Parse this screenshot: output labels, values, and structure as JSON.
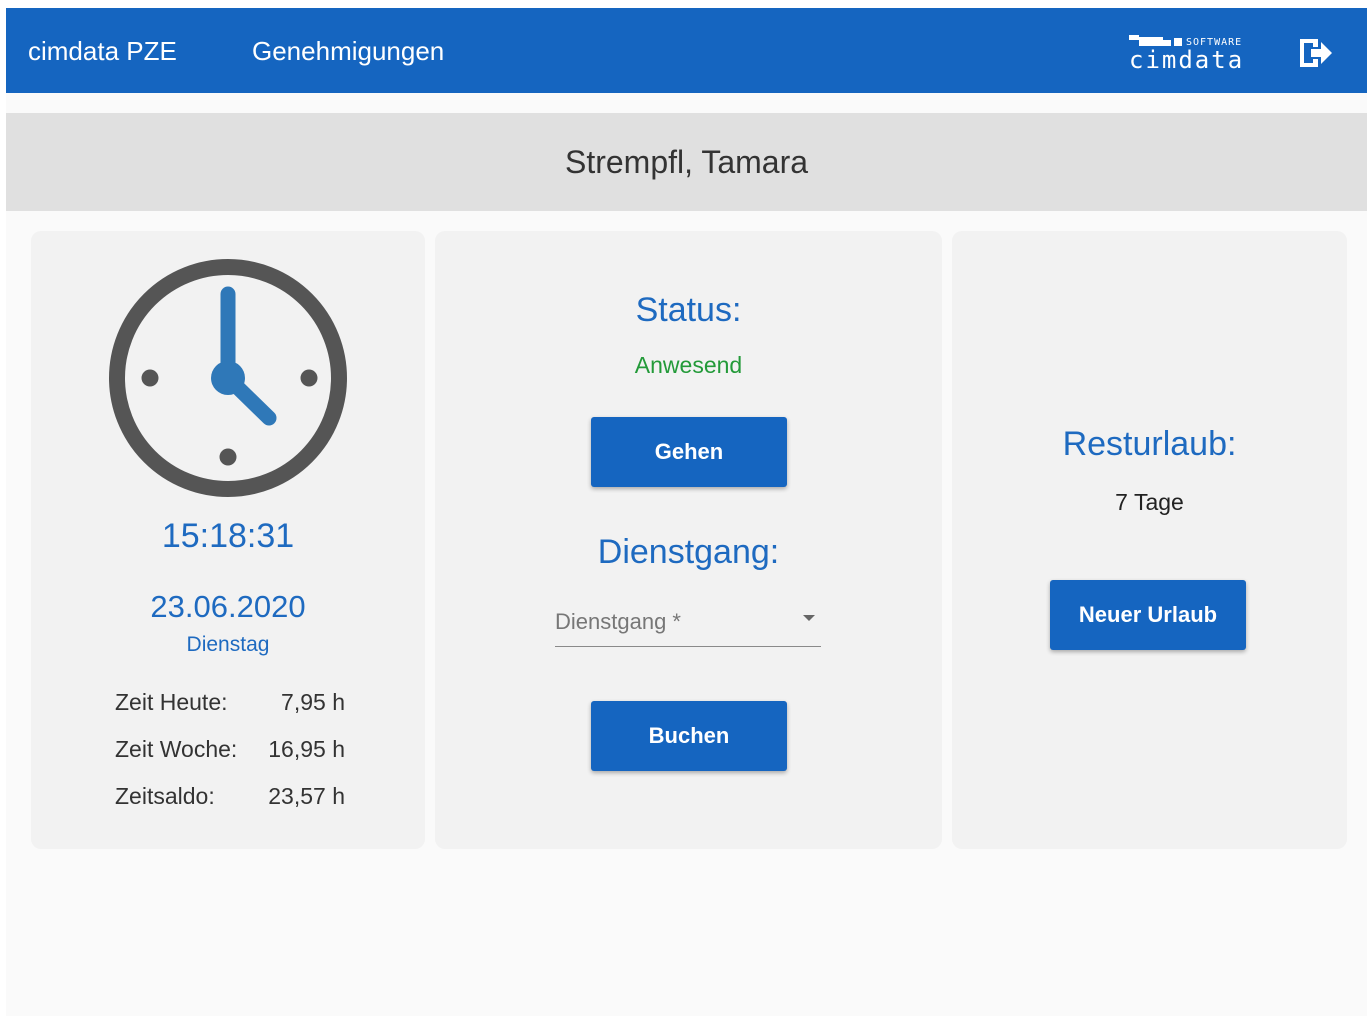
{
  "topbar": {
    "brand": "cimdata PZE",
    "nav_approvals": "Genehmigungen",
    "logo_small": "SOFTWARE",
    "logo_big": "cimdata",
    "colors": {
      "bar": "#1565c0"
    }
  },
  "employee": {
    "name": "Strempfl, Tamara"
  },
  "clock_card": {
    "time": "15:18:31",
    "date": "23.06.2020",
    "weekday": "Dienstag",
    "stats": [
      {
        "label": "Zeit Heute:",
        "value": "7,95 h"
      },
      {
        "label": "Zeit Woche:",
        "value": "16,95 h"
      },
      {
        "label": "Zeitsaldo:",
        "value": "23,57 h"
      }
    ]
  },
  "status_card": {
    "status_title": "Status:",
    "status_value": "Anwesend",
    "go_button": "Gehen",
    "duty_title": "Dienstgang:",
    "duty_select_placeholder": "Dienstgang *",
    "book_button": "Buchen",
    "colors": {
      "status_ok": "#239a39"
    }
  },
  "vacation_card": {
    "title": "Resturlaub:",
    "value": "7 Tage",
    "new_button": "Neuer Urlaub"
  }
}
